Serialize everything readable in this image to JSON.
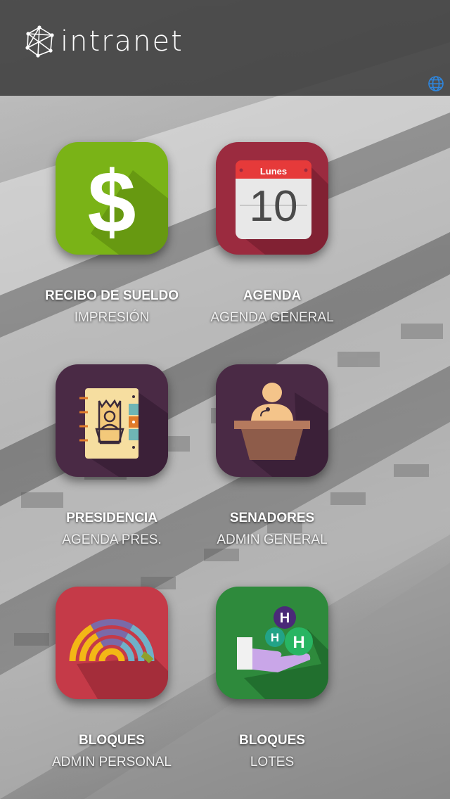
{
  "header": {
    "brand": "intranet",
    "logo_icon": "network-cube-logo",
    "globe_icon": "globe-icon"
  },
  "calendar": {
    "month_label": "Lunes",
    "day": "10"
  },
  "tiles": [
    {
      "title": "RECIBO DE SUELDO",
      "subtitle": "IMPRESIÓN",
      "icon": "dollar-icon",
      "color": "#7ab317"
    },
    {
      "title": "AGENDA",
      "subtitle": "AGENDA GENERAL",
      "icon": "calendar-icon",
      "color": "#9b2b3f"
    },
    {
      "title": "PRESIDENCIA",
      "subtitle": "AGENDA PRES.",
      "icon": "agenda-book-icon",
      "color": "#4a2a45"
    },
    {
      "title": "SENADORES",
      "subtitle": "ADMIN GENERAL",
      "icon": "speaker-podium-icon",
      "color": "#4a2a45"
    },
    {
      "title": "BLOQUES",
      "subtitle": "ADMIN PERSONAL",
      "icon": "hemicycle-icon",
      "color": "#c53a48"
    },
    {
      "title": "BLOQUES",
      "subtitle": "LOTES",
      "icon": "hand-molecules-icon",
      "color": "#2e8a3c"
    }
  ],
  "molecule_letters": [
    "H",
    "H",
    "H"
  ]
}
